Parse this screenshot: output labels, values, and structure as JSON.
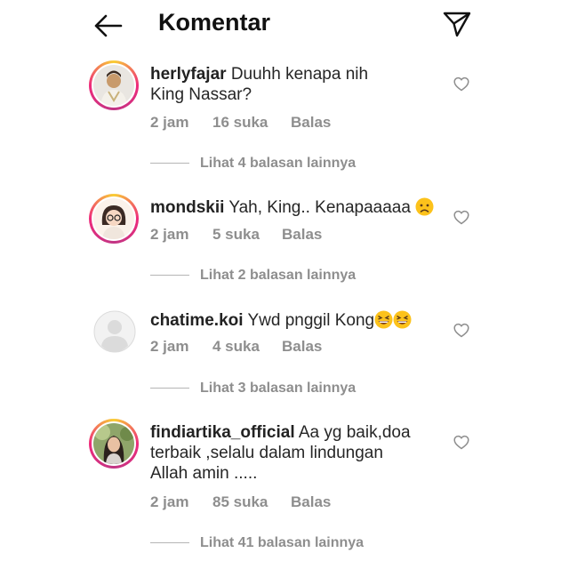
{
  "header": {
    "title": "Komentar",
    "back_icon": "arrow-left-icon",
    "send_icon": "paper-plane-icon"
  },
  "colors": {
    "text": "#262626",
    "meta": "#8e8e8e",
    "ring_start": "#f9ce34",
    "ring_end": "#ee2a7b"
  },
  "comments": [
    {
      "username": "herlyfajar",
      "text_line1": "Duuhh kenapa nih",
      "text_line2": "King Nassar?",
      "time": "2 jam",
      "likes": "16 suka",
      "reply_label": "Balas",
      "view_replies": "Lihat 4 balasan lainnya"
    },
    {
      "username": "mondskii",
      "text_line1": "Yah, King.. Kenapaaaaa",
      "emoji": "worried-face-emoji",
      "time": "2 jam",
      "likes": "5 suka",
      "reply_label": "Balas",
      "view_replies": "Lihat 2 balasan lainnya"
    },
    {
      "username": "chatime.koi",
      "text_line1": "Ywd pnggil Kong",
      "emoji": "grinning-squinting-face-emoji",
      "time": "2 jam",
      "likes": "4 suka",
      "reply_label": "Balas",
      "view_replies": "Lihat 3 balasan lainnya"
    },
    {
      "username": "findiartika_official",
      "text_line1": "Aa yg baik,doa",
      "text_line2": "terbaik ,selalu dalam lindungan",
      "text_line3": "Allah amin .....",
      "time": "2 jam",
      "likes": "85 suka",
      "reply_label": "Balas",
      "view_replies": "Lihat 41 balasan lainnya"
    }
  ]
}
